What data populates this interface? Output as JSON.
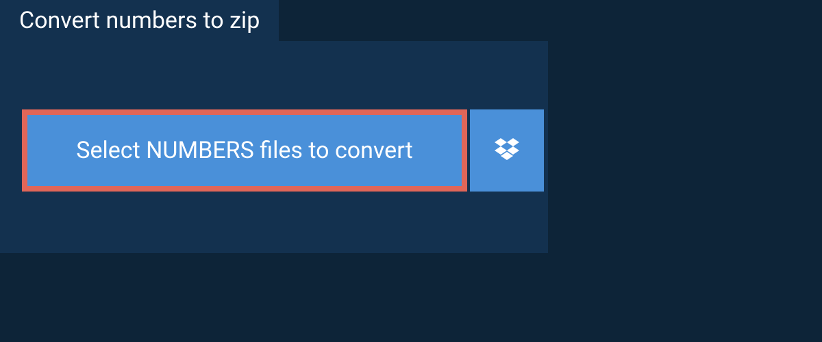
{
  "tab": {
    "label": "Convert numbers to zip"
  },
  "selectButton": {
    "label": "Select NUMBERS files to convert"
  },
  "colors": {
    "background": "#0d2438",
    "panel": "#13314f",
    "button": "#4a90d9",
    "highlight": "#e16658"
  }
}
